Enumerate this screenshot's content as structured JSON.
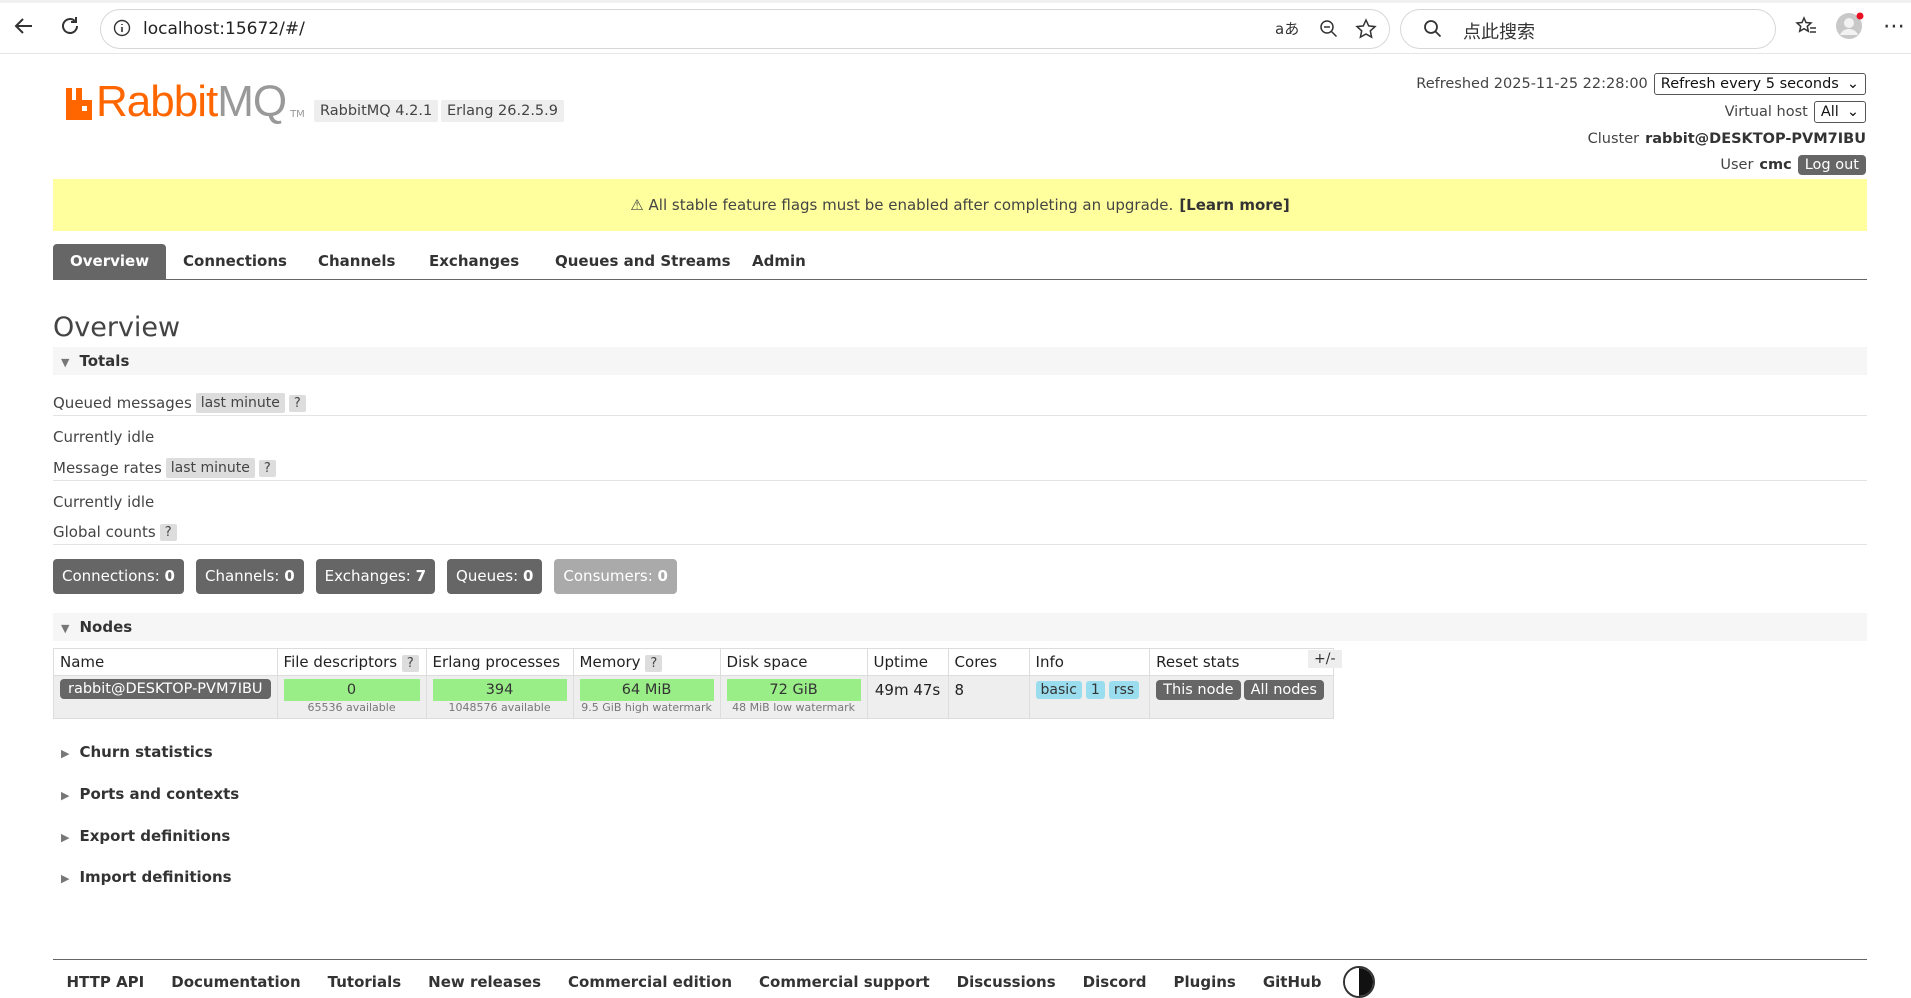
{
  "browser": {
    "url": "localhost:15672/#/",
    "search_placeholder": "点此搜索"
  },
  "header": {
    "logo_rabbit": "Rabbit",
    "logo_mq": "MQ",
    "logo_tm": "TM",
    "version_rabbitmq": "RabbitMQ 4.2.1",
    "version_erlang": "Erlang 26.2.5.9",
    "refreshed_label": "Refreshed 2025-11-25 22:28:00",
    "refresh_select": "Refresh every 5 seconds",
    "vhost_label": "Virtual host",
    "vhost_select": "All",
    "cluster_label": "Cluster",
    "cluster_name": "rabbit@DESKTOP-PVM7IBU",
    "user_label": "User",
    "user_name": "cmc",
    "logout_label": "Log out"
  },
  "banner": {
    "text": "⚠ All stable feature flags must be enabled after completing an upgrade.",
    "link": "[Learn more]"
  },
  "tabs": [
    {
      "label": "Overview",
      "active": true
    },
    {
      "label": "Connections"
    },
    {
      "label": "Channels"
    },
    {
      "label": "Exchanges"
    },
    {
      "label": "Queues and Streams"
    },
    {
      "label": "Admin"
    }
  ],
  "page_title": "Overview",
  "totals": {
    "header": "Totals",
    "queued_label": "Queued messages",
    "queued_range": "last minute",
    "queued_status": "Currently idle",
    "rates_label": "Message rates",
    "rates_range": "last minute",
    "rates_status": "Currently idle",
    "global_label": "Global counts",
    "help": "?",
    "counts": [
      {
        "label": "Connections:",
        "value": "0"
      },
      {
        "label": "Channels:",
        "value": "0"
      },
      {
        "label": "Exchanges:",
        "value": "7"
      },
      {
        "label": "Queues:",
        "value": "0"
      },
      {
        "label": "Consumers:",
        "value": "0"
      }
    ]
  },
  "nodes": {
    "header": "Nodes",
    "columns": {
      "name": "Name",
      "fd": "File descriptors",
      "erl": "Erlang processes",
      "mem": "Memory",
      "disk": "Disk space",
      "uptime": "Uptime",
      "cores": "Cores",
      "info": "Info",
      "reset": "Reset stats"
    },
    "toggle": "+/-",
    "row": {
      "name": "rabbit@DESKTOP-PVM7IBU",
      "fd_value": "0",
      "fd_sub": "65536 available",
      "erl_value": "394",
      "erl_sub": "1048576 available",
      "mem_value": "64 MiB",
      "mem_sub": "9.5 GiB high watermark",
      "disk_value": "72 GiB",
      "disk_sub": "48 MiB low watermark",
      "uptime": "49m 47s",
      "cores": "8",
      "info_tags": [
        "basic",
        "1",
        "rss"
      ],
      "reset_this": "This node",
      "reset_all": "All nodes"
    }
  },
  "sections": [
    "Churn statistics",
    "Ports and contexts",
    "Export definitions",
    "Import definitions"
  ],
  "footer": [
    "HTTP API",
    "Documentation",
    "Tutorials",
    "New releases",
    "Commercial edition",
    "Commercial support",
    "Discussions",
    "Discord",
    "Plugins",
    "GitHub"
  ]
}
